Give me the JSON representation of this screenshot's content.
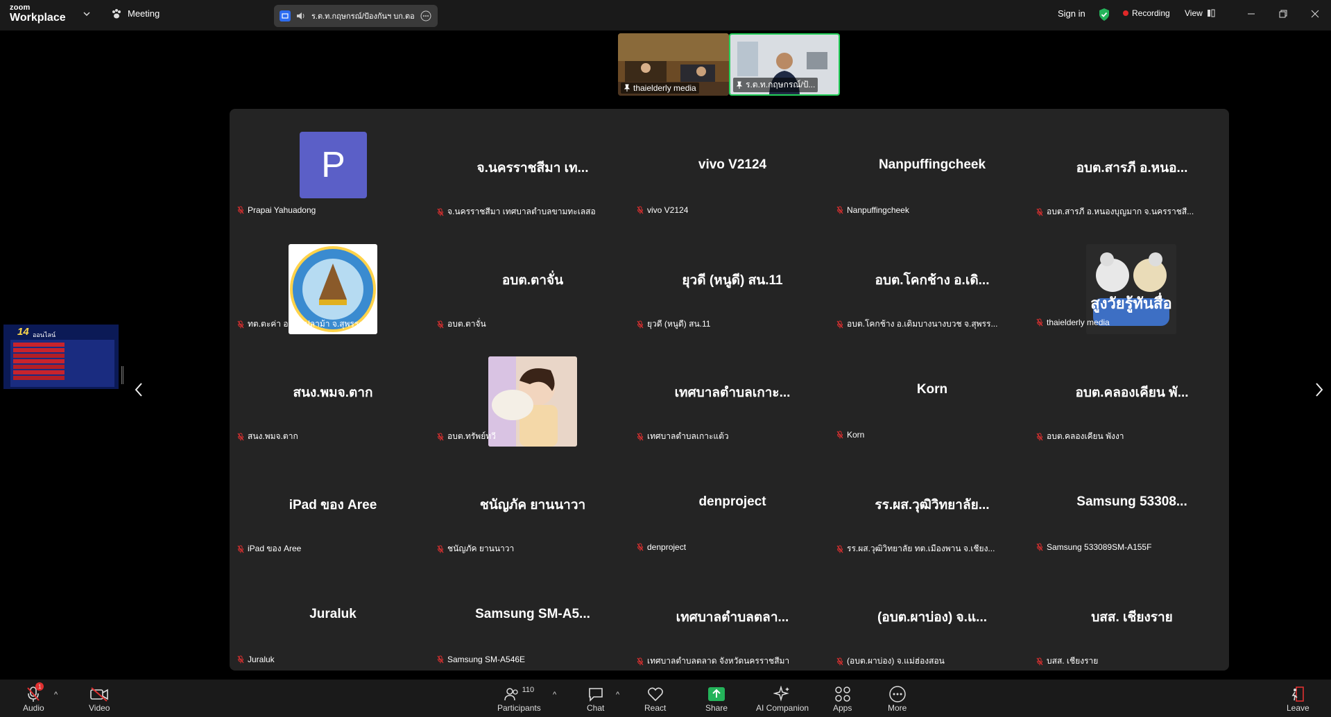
{
  "app": {
    "brand_top": "zoom",
    "brand_bottom": "Workplace"
  },
  "topbar": {
    "meeting_label": "Meeting",
    "share_pill_text": "ร.ต.ท.กฤษกรณ์/ป้องกันฯ บก.ตอ",
    "signin": "Sign in",
    "recording": "Recording",
    "view": "View"
  },
  "thumbnails": [
    {
      "name": "thaielderly media"
    },
    {
      "name": "ร.ต.ท.กฤษกรณ์/ป้..."
    }
  ],
  "gallery": {
    "tiles": [
      {
        "center": "",
        "label": "Prapai Yahuadong",
        "type": "avatar",
        "avatar_letter": "P"
      },
      {
        "center": "จ.นครราชสีมา เท...",
        "label": "จ.นครราชสีมา เทศบาลตำบลขามทะเลสอ",
        "type": "name"
      },
      {
        "center": "vivo V2124",
        "label": "vivo V2124",
        "type": "name"
      },
      {
        "center": "Nanpuffingcheek",
        "label": "Nanpuffingcheek",
        "type": "name"
      },
      {
        "center": "อบต.สารภี อ.หนอ...",
        "label": "อบต.สารภี อ.หนองบุญมาก จ.นครราชสี...",
        "type": "name"
      },
      {
        "center": "",
        "label": "ทต.ตะค่า อ.บางปลาม้า จ.สุพรรณบุรี",
        "type": "logo"
      },
      {
        "center": "อบต.ตาจั่น",
        "label": "อบต.ตาจั่น",
        "type": "name"
      },
      {
        "center": "ยุวดี (หนูดี) สน.11",
        "label": "ยุวดี (หนูดี) สน.11",
        "type": "name"
      },
      {
        "center": "อบต.โคกช้าง อ.เดิ...",
        "label": "อบต.โคกช้าง อ.เดิมบางนางบวช จ.สุพรร...",
        "type": "name"
      },
      {
        "center": "",
        "label": "thaielderly media",
        "type": "sticker",
        "sticker_text": "สูงวัยรู้ทันสื่อ"
      },
      {
        "center": "สนง.พมจ.ตาก",
        "label": "สนง.พมจ.ตาก",
        "type": "name"
      },
      {
        "center": "",
        "label": "อบต.ทรัพย์ทวี",
        "type": "photo"
      },
      {
        "center": "เทศบาลตำบลเกาะ...",
        "label": "เทศบาลตำบลเกาะแต้ว",
        "type": "name"
      },
      {
        "center": "Korn",
        "label": "Korn",
        "type": "name"
      },
      {
        "center": "อบต.คลองเคียน พั...",
        "label": "อบต.คลองเคียน พังงา",
        "type": "name"
      },
      {
        "center": "iPad ของ Aree",
        "label": "iPad ของ Aree",
        "type": "name"
      },
      {
        "center": "ชนัญภัค ยานนาวา",
        "label": "ชนัญภัค ยานนาวา",
        "type": "name"
      },
      {
        "center": "denproject",
        "label": "denproject",
        "type": "name"
      },
      {
        "center": "รร.ผส.วุฒิวิทยาลัย...",
        "label": "รร.ผส.วุฒิวิทยาลัย ทต.เมืองพาน จ.เชียง...",
        "type": "name"
      },
      {
        "center": "Samsung 53308...",
        "label": "Samsung 533089SM-A155F",
        "type": "name"
      },
      {
        "center": "Juraluk",
        "label": "Juraluk",
        "type": "name"
      },
      {
        "center": "Samsung SM-A5...",
        "label": "Samsung SM-A546E",
        "type": "name"
      },
      {
        "center": "เทศบาลตำบลตลา...",
        "label": "เทศบาลตำบลตลาด จังหวัดนครราชสีมา",
        "type": "name"
      },
      {
        "center": "(อบต.ผาบ่อง) จ.แ...",
        "label": "(อบต.ผาบ่อง) จ.แม่ฮ่องสอน",
        "type": "name"
      },
      {
        "center": "บสส. เชียงราย",
        "label": "บสส. เชียงราย",
        "type": "name"
      }
    ]
  },
  "left_share_thumb": {
    "number": "14",
    "caption": "ออนไลน์"
  },
  "bottombar": {
    "audio": "Audio",
    "video": "Video",
    "participants": "Participants",
    "participants_count": "110",
    "chat": "Chat",
    "react": "React",
    "share": "Share",
    "ai_companion": "AI Companion",
    "apps": "Apps",
    "more": "More",
    "leave": "Leave",
    "audio_badge": "1"
  },
  "colors": {
    "accent_green": "#24b35a",
    "record_red": "#e02828",
    "avatar_purple": "#5b5fc7"
  }
}
